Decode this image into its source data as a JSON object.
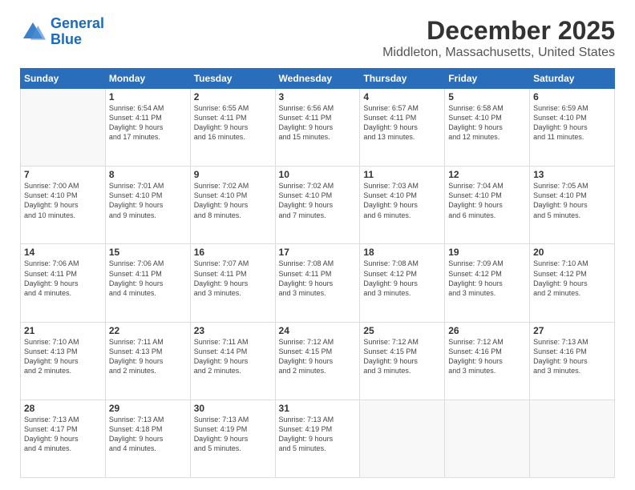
{
  "header": {
    "logo_line1": "General",
    "logo_line2": "Blue",
    "title": "December 2025",
    "subtitle": "Middleton, Massachusetts, United States"
  },
  "calendar": {
    "days_of_week": [
      "Sunday",
      "Monday",
      "Tuesday",
      "Wednesday",
      "Thursday",
      "Friday",
      "Saturday"
    ],
    "weeks": [
      [
        {
          "day": "",
          "info": ""
        },
        {
          "day": "1",
          "info": "Sunrise: 6:54 AM\nSunset: 4:11 PM\nDaylight: 9 hours\nand 17 minutes."
        },
        {
          "day": "2",
          "info": "Sunrise: 6:55 AM\nSunset: 4:11 PM\nDaylight: 9 hours\nand 16 minutes."
        },
        {
          "day": "3",
          "info": "Sunrise: 6:56 AM\nSunset: 4:11 PM\nDaylight: 9 hours\nand 15 minutes."
        },
        {
          "day": "4",
          "info": "Sunrise: 6:57 AM\nSunset: 4:11 PM\nDaylight: 9 hours\nand 13 minutes."
        },
        {
          "day": "5",
          "info": "Sunrise: 6:58 AM\nSunset: 4:10 PM\nDaylight: 9 hours\nand 12 minutes."
        },
        {
          "day": "6",
          "info": "Sunrise: 6:59 AM\nSunset: 4:10 PM\nDaylight: 9 hours\nand 11 minutes."
        }
      ],
      [
        {
          "day": "7",
          "info": "Sunrise: 7:00 AM\nSunset: 4:10 PM\nDaylight: 9 hours\nand 10 minutes."
        },
        {
          "day": "8",
          "info": "Sunrise: 7:01 AM\nSunset: 4:10 PM\nDaylight: 9 hours\nand 9 minutes."
        },
        {
          "day": "9",
          "info": "Sunrise: 7:02 AM\nSunset: 4:10 PM\nDaylight: 9 hours\nand 8 minutes."
        },
        {
          "day": "10",
          "info": "Sunrise: 7:02 AM\nSunset: 4:10 PM\nDaylight: 9 hours\nand 7 minutes."
        },
        {
          "day": "11",
          "info": "Sunrise: 7:03 AM\nSunset: 4:10 PM\nDaylight: 9 hours\nand 6 minutes."
        },
        {
          "day": "12",
          "info": "Sunrise: 7:04 AM\nSunset: 4:10 PM\nDaylight: 9 hours\nand 6 minutes."
        },
        {
          "day": "13",
          "info": "Sunrise: 7:05 AM\nSunset: 4:10 PM\nDaylight: 9 hours\nand 5 minutes."
        }
      ],
      [
        {
          "day": "14",
          "info": "Sunrise: 7:06 AM\nSunset: 4:11 PM\nDaylight: 9 hours\nand 4 minutes."
        },
        {
          "day": "15",
          "info": "Sunrise: 7:06 AM\nSunset: 4:11 PM\nDaylight: 9 hours\nand 4 minutes."
        },
        {
          "day": "16",
          "info": "Sunrise: 7:07 AM\nSunset: 4:11 PM\nDaylight: 9 hours\nand 3 minutes."
        },
        {
          "day": "17",
          "info": "Sunrise: 7:08 AM\nSunset: 4:11 PM\nDaylight: 9 hours\nand 3 minutes."
        },
        {
          "day": "18",
          "info": "Sunrise: 7:08 AM\nSunset: 4:12 PM\nDaylight: 9 hours\nand 3 minutes."
        },
        {
          "day": "19",
          "info": "Sunrise: 7:09 AM\nSunset: 4:12 PM\nDaylight: 9 hours\nand 3 minutes."
        },
        {
          "day": "20",
          "info": "Sunrise: 7:10 AM\nSunset: 4:12 PM\nDaylight: 9 hours\nand 2 minutes."
        }
      ],
      [
        {
          "day": "21",
          "info": "Sunrise: 7:10 AM\nSunset: 4:13 PM\nDaylight: 9 hours\nand 2 minutes."
        },
        {
          "day": "22",
          "info": "Sunrise: 7:11 AM\nSunset: 4:13 PM\nDaylight: 9 hours\nand 2 minutes."
        },
        {
          "day": "23",
          "info": "Sunrise: 7:11 AM\nSunset: 4:14 PM\nDaylight: 9 hours\nand 2 minutes."
        },
        {
          "day": "24",
          "info": "Sunrise: 7:12 AM\nSunset: 4:15 PM\nDaylight: 9 hours\nand 2 minutes."
        },
        {
          "day": "25",
          "info": "Sunrise: 7:12 AM\nSunset: 4:15 PM\nDaylight: 9 hours\nand 3 minutes."
        },
        {
          "day": "26",
          "info": "Sunrise: 7:12 AM\nSunset: 4:16 PM\nDaylight: 9 hours\nand 3 minutes."
        },
        {
          "day": "27",
          "info": "Sunrise: 7:13 AM\nSunset: 4:16 PM\nDaylight: 9 hours\nand 3 minutes."
        }
      ],
      [
        {
          "day": "28",
          "info": "Sunrise: 7:13 AM\nSunset: 4:17 PM\nDaylight: 9 hours\nand 4 minutes."
        },
        {
          "day": "29",
          "info": "Sunrise: 7:13 AM\nSunset: 4:18 PM\nDaylight: 9 hours\nand 4 minutes."
        },
        {
          "day": "30",
          "info": "Sunrise: 7:13 AM\nSunset: 4:19 PM\nDaylight: 9 hours\nand 5 minutes."
        },
        {
          "day": "31",
          "info": "Sunrise: 7:13 AM\nSunset: 4:19 PM\nDaylight: 9 hours\nand 5 minutes."
        },
        {
          "day": "",
          "info": ""
        },
        {
          "day": "",
          "info": ""
        },
        {
          "day": "",
          "info": ""
        }
      ]
    ]
  }
}
